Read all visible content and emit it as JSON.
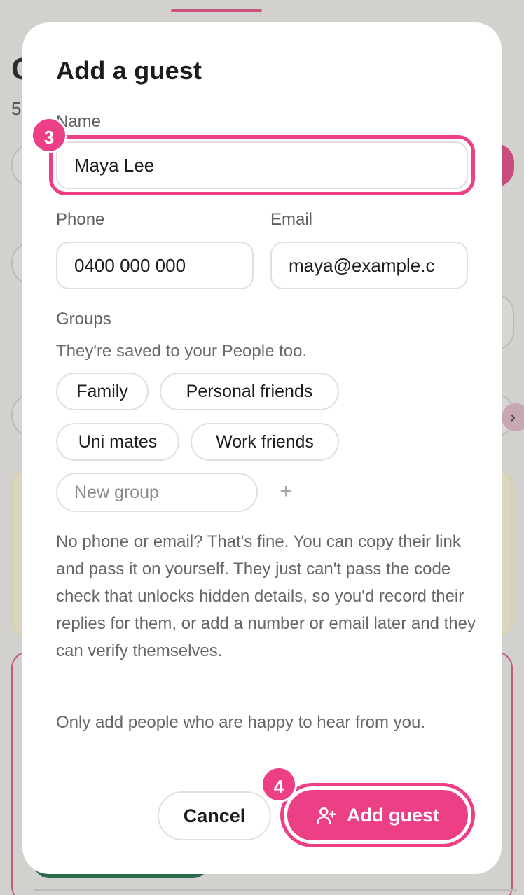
{
  "background": {
    "heading_fragment": "C",
    "sub_fragment": "5"
  },
  "modal": {
    "title": "Add a guest",
    "name": {
      "label": "Name",
      "value": "Maya Lee",
      "step": "3"
    },
    "phone": {
      "label": "Phone",
      "value": "0400 000 000"
    },
    "email": {
      "label": "Email",
      "value": "maya@example.c"
    },
    "groups": {
      "label": "Groups",
      "hint": "They're saved to your People too.",
      "chips": [
        "Family",
        "Personal friends",
        "Uni mates",
        "Work friends"
      ],
      "new_group_placeholder": "New group",
      "add_symbol": "+"
    },
    "info_paragraph": "No phone or email? That's fine. You can copy their link and pass it on yourself. They just can't pass the code check that unlocks hidden details, so you'd record their replies for them, or add a number or email later and they can verify themselves.",
    "consent_paragraph": "Only add people who are happy to hear from you.",
    "actions": {
      "cancel_label": "Cancel",
      "add_label": "Add guest",
      "add_step": "4",
      "add_icon": "user-plus-icon"
    }
  },
  "colors": {
    "accent": "#ec3f86",
    "overlay": "#d3d1ce"
  }
}
